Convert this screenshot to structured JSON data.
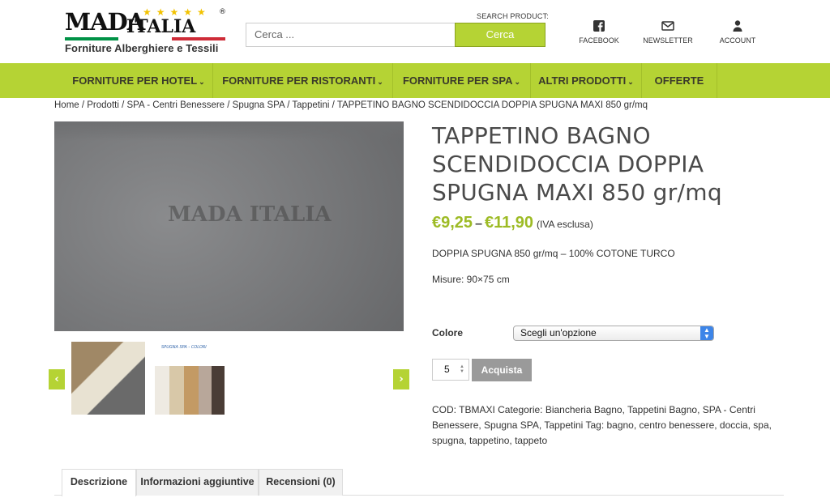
{
  "brand": {
    "name_part1": "MADA",
    "name_part2": "ITALIA",
    "stars": "★★★★★",
    "reg": "®",
    "tagline": "Forniture Alberghiere e Tessili",
    "flag_colors": [
      "#009246",
      "#ffffff",
      "#ce2b37"
    ]
  },
  "search": {
    "label": "SEARCH PRODUCT:",
    "placeholder": "Cerca ...",
    "button_label": "Cerca"
  },
  "header_links": [
    {
      "label": "FACEBOOK",
      "icon": "facebook-icon"
    },
    {
      "label": "NEWSLETTER",
      "icon": "envelope-icon"
    },
    {
      "label": "ACCOUNT",
      "icon": "user-icon"
    }
  ],
  "nav": [
    {
      "label": "FORNITURE PER HOTEL",
      "chevron": "⌄"
    },
    {
      "label": "FORNITURE PER RISTORANTI",
      "chevron": "⌄"
    },
    {
      "label": "FORNITURE PER SPA",
      "chevron": "⌄"
    },
    {
      "label": "ALTRI PRODOTTI",
      "chevron": "⌄"
    },
    {
      "label": "OFFERTE",
      "chevron": ""
    }
  ],
  "breadcrumb": "Home / Prodotti / SPA - Centri Benessere / Spugna SPA / Tappetini / TAPPETINO BAGNO SCENDIDOCCIA DOPPIA SPUGNA MAXI 850 gr/mq",
  "gallery": {
    "watermark": "MADA ITALIA",
    "thumb2_caption": "SPUGNA SPA - COLORI",
    "prev_arrow": "‹",
    "next_arrow": "›"
  },
  "product": {
    "title": "TAPPETINO BAGNO SCENDIDOCCIA DOPPIA SPUGNA MAXI 850 gr/mq",
    "price_min": "€9,25",
    "price_sep": "–",
    "price_max": "€11,90",
    "vat_note": "(IVA esclusa)",
    "description": "DOPPIA SPUGNA 850 gr/mq – 100% COTONE TURCO",
    "measures": "Misure:  90×75 cm",
    "color_label": "Colore",
    "color_select": "Scegli un'opzione",
    "quantity": "5",
    "buy_label": "Acquista",
    "meta": "COD: TBMAXI Categorie: Biancheria Bagno, Tappetini Bagno, SPA - Centri Benessere, Spugna SPA, Tappetini Tag: bagno, centro benessere, doccia, spa, spugna, tappetino, tappeto"
  },
  "tabs": [
    {
      "label": "Descrizione"
    },
    {
      "label": "Informazioni aggiuntive"
    },
    {
      "label": "Recensioni (0)"
    }
  ],
  "colors": {
    "accent_green": "#b5d334",
    "price_green": "#9dbb25",
    "button_gray": "#9a9a9a"
  }
}
